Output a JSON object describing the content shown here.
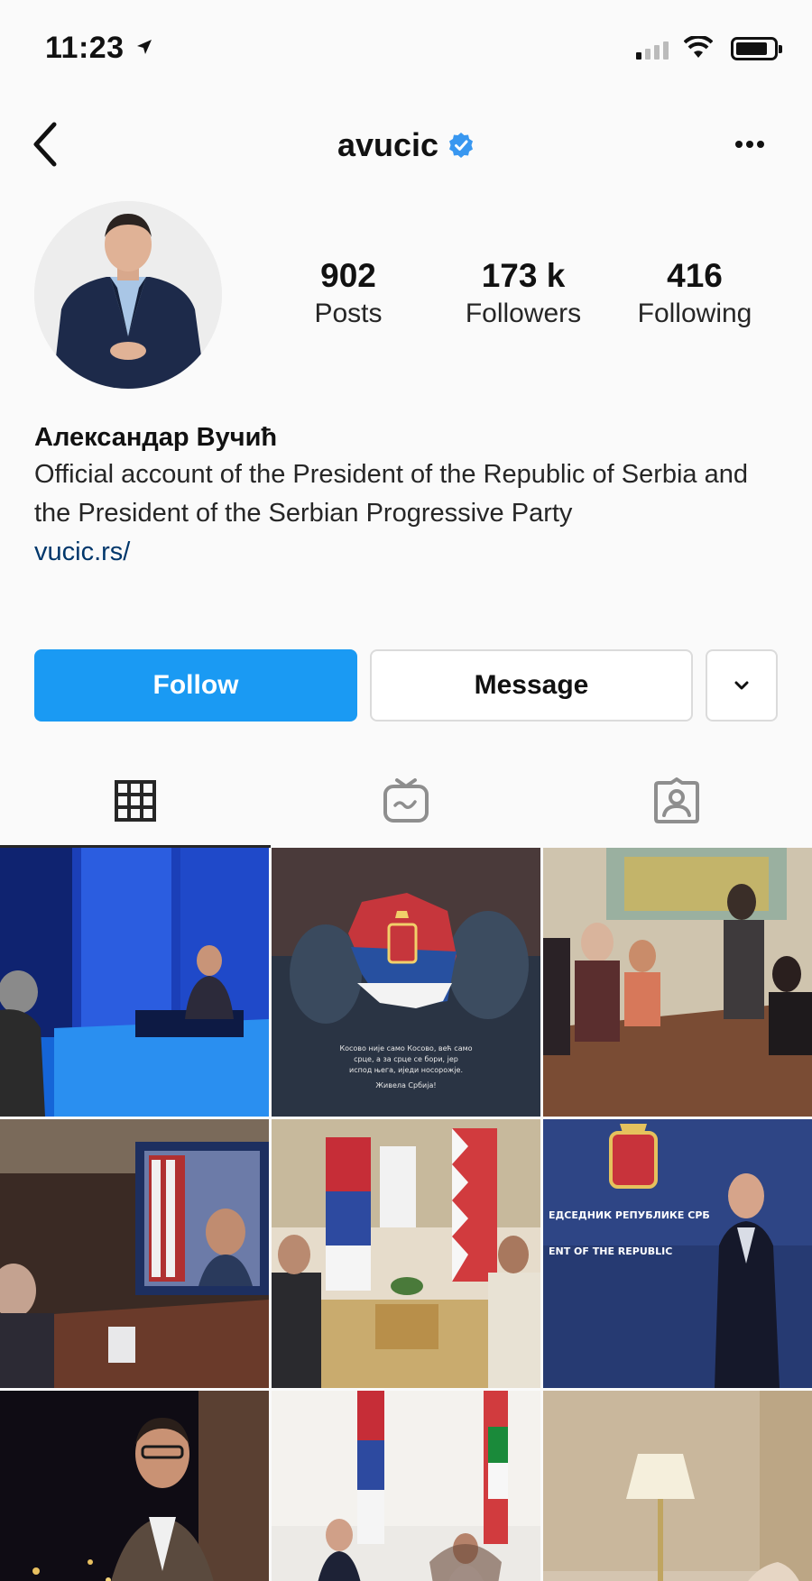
{
  "status_bar": {
    "time": "11:23",
    "icons": [
      "location-arrow-icon",
      "cellular-signal-icon",
      "wifi-icon",
      "battery-icon"
    ]
  },
  "header": {
    "username": "avucic",
    "verified": true,
    "back_icon": "chevron-left-icon",
    "more_icon": "ellipsis-icon"
  },
  "profile": {
    "stats": [
      {
        "value": "902",
        "label": "Posts"
      },
      {
        "value": "173 k",
        "label": "Followers"
      },
      {
        "value": "416",
        "label": "Following"
      }
    ],
    "full_name": "Александар Вучић",
    "bio": "Official account of the President of the Republic of Serbia and the President of the Serbian Progressive Party",
    "link": "vucic.rs/"
  },
  "actions": {
    "follow_label": "Follow",
    "message_label": "Message",
    "more_icon": "chevron-down-icon"
  },
  "tabs": [
    {
      "name": "posts-grid",
      "icon": "grid-icon",
      "active": true
    },
    {
      "name": "igtv",
      "icon": "igtv-icon",
      "active": false
    },
    {
      "name": "tagged",
      "icon": "tagged-person-icon",
      "active": false
    }
  ],
  "grid_posts": [
    {
      "caption": "",
      "theme": "blue-studio"
    },
    {
      "caption": "Косово није само Косово, већ само срце, а за срце се бори, јер испод њега, иједи носорожје. Живела Србија!",
      "theme": "dark-flag-map"
    },
    {
      "caption": "",
      "theme": "meeting-masks"
    },
    {
      "caption": "",
      "theme": "video-call"
    },
    {
      "caption": "",
      "theme": "flags-ceremony"
    },
    {
      "caption": "ПРЕДСЕДНИК РЕПУБЛИКЕ СРБИЈЕ / ENT OF THE REPUBLIC",
      "theme": "press-blue"
    },
    {
      "caption": "",
      "theme": "night-portrait"
    },
    {
      "caption": "",
      "theme": "bilateral-meeting"
    },
    {
      "caption": "",
      "theme": "lamp-room"
    }
  ],
  "colors": {
    "accent": "#1a9af3",
    "link": "#00376b",
    "verified": "#3897f0"
  }
}
